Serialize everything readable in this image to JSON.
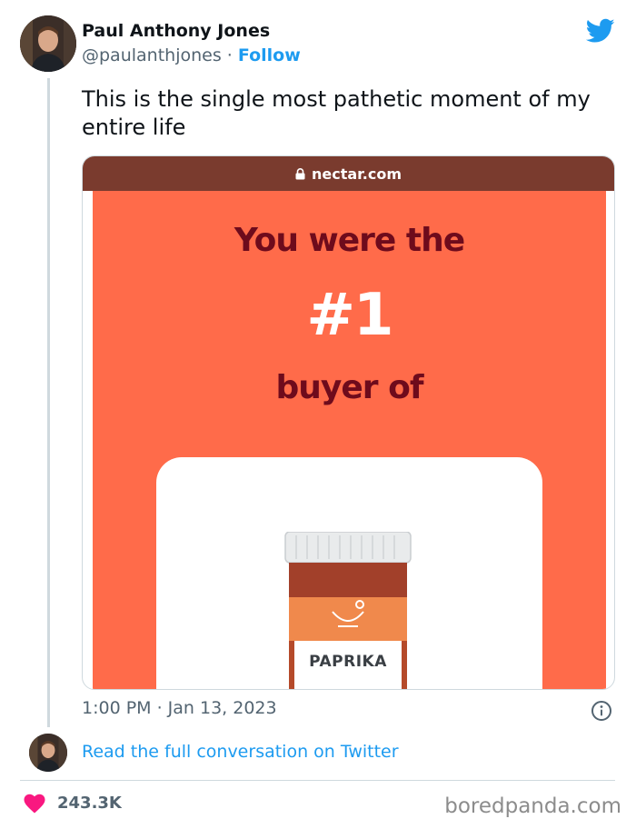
{
  "author": {
    "name": "Paul Anthony Jones",
    "handle": "@paulanthjones",
    "separator": " · ",
    "follow_label": "Follow"
  },
  "tweet": {
    "text": "This is the single most pathetic moment of my entire life",
    "timestamp": "1:00 PM · Jan 13, 2023"
  },
  "media": {
    "browser_url": "nectar.com",
    "promo_line1": "You were the",
    "promo_rank": "#1",
    "promo_line2": "buyer of",
    "product_label": "PAPRIKA"
  },
  "footer": {
    "read_link": "Read the full conversation on Twitter",
    "like_count": "243.3K",
    "watermark": "boredpanda.com"
  },
  "icons": {
    "twitter": "twitter-bird-icon",
    "lock": "lock-icon",
    "info": "info-icon",
    "heart": "heart-icon"
  },
  "colors": {
    "twitter_blue": "#1d9bf0",
    "promo_background": "#ff6b4a",
    "promo_text": "#6e0b1c",
    "browser_bar": "#7a3b2e",
    "heart": "#f91880"
  }
}
